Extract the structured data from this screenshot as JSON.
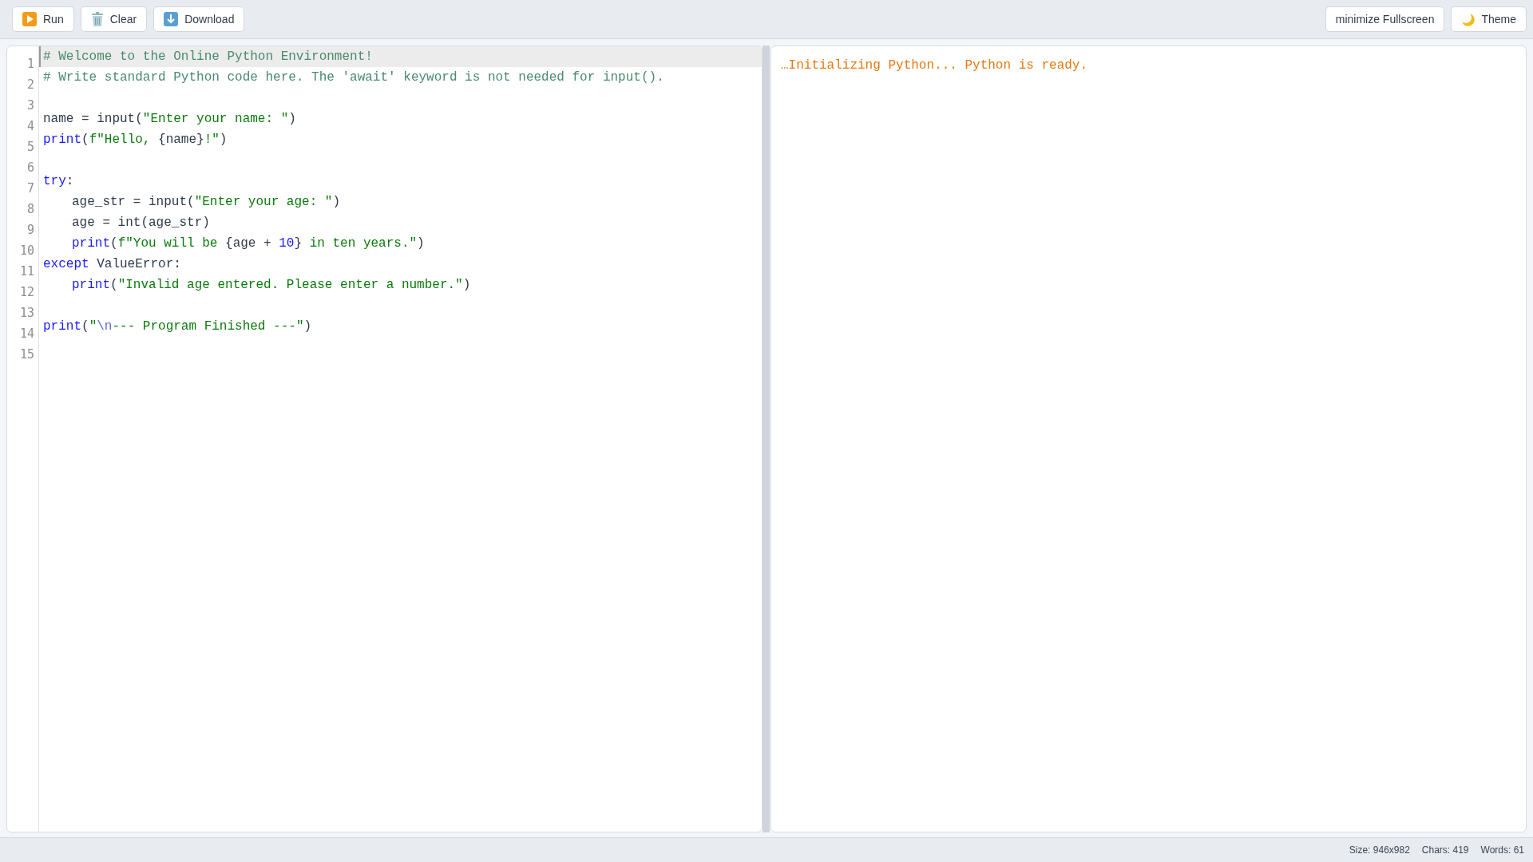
{
  "toolbar": {
    "left_buttons": [
      {
        "kind": "run",
        "label": "Run"
      },
      {
        "kind": "clear",
        "label": "Clear"
      },
      {
        "kind": "download",
        "label": "Download"
      }
    ],
    "right_buttons": [
      {
        "kind": "fullscreen",
        "label": "minimize Fullscreen"
      },
      {
        "kind": "theme",
        "label": "Theme"
      }
    ]
  },
  "editor": {
    "lines": [
      {
        "number": "1",
        "active": true,
        "indented": false,
        "tokens": [
          {
            "kind": "comment",
            "t": "# Welcome to the Online Python Environment!"
          }
        ]
      },
      {
        "number": "2",
        "active": false,
        "indented": false,
        "tokens": [
          {
            "kind": "comment",
            "t": "# Write standard Python code here. The 'await' keyword is not needed for input()."
          }
        ]
      },
      {
        "number": "3",
        "active": false
      },
      {
        "number": "4",
        "active": false,
        "indented": false,
        "tokens": [
          {
            "kind": "plain",
            "t": "name = input("
          },
          {
            "kind": "string",
            "t": "\"Enter your name: \""
          },
          {
            "kind": "plain",
            "t": ")"
          }
        ]
      },
      {
        "number": "5",
        "active": false,
        "indented": false,
        "tokens": [
          {
            "kind": "keyword",
            "t": "print"
          },
          {
            "kind": "plain",
            "t": "("
          },
          {
            "kind": "string",
            "t": "f\"Hello, "
          },
          {
            "kind": "plain",
            "t": "{name}"
          },
          {
            "kind": "string",
            "t": "!\""
          },
          {
            "kind": "plain",
            "t": ")"
          }
        ]
      },
      {
        "number": "6",
        "active": false
      },
      {
        "number": "7",
        "active": false,
        "indented": false,
        "tokens": [
          {
            "kind": "keyword",
            "t": "try"
          },
          {
            "kind": "plain",
            "t": ":"
          }
        ]
      },
      {
        "number": "8",
        "active": false,
        "indented": true,
        "tokens": [
          {
            "kind": "plain",
            "t": "age_str = input("
          },
          {
            "kind": "string",
            "t": "\"Enter your age: \""
          },
          {
            "kind": "plain",
            "t": ")"
          }
        ]
      },
      {
        "number": "9",
        "active": false,
        "indented": true,
        "tokens": [
          {
            "kind": "plain",
            "t": "age = int(age_str)"
          }
        ]
      },
      {
        "number": "10",
        "active": false,
        "indented": true,
        "tokens": [
          {
            "kind": "keyword",
            "t": "print"
          },
          {
            "kind": "plain",
            "t": "("
          },
          {
            "kind": "string",
            "t": "f\"You will be "
          },
          {
            "kind": "plain",
            "t": "{age + "
          },
          {
            "kind": "number",
            "t": "10"
          },
          {
            "kind": "plain",
            "t": "}"
          },
          {
            "kind": "string",
            "t": " in ten years.\""
          },
          {
            "kind": "plain",
            "t": ")"
          }
        ]
      },
      {
        "number": "11",
        "active": false,
        "indented": false,
        "tokens": [
          {
            "kind": "keyword",
            "t": "except"
          },
          {
            "kind": "plain",
            "t": " ValueError:"
          }
        ]
      },
      {
        "number": "12",
        "active": false,
        "indented": true,
        "tokens": [
          {
            "kind": "keyword",
            "t": "print"
          },
          {
            "kind": "plain",
            "t": "("
          },
          {
            "kind": "string",
            "t": "\"Invalid age entered. Please enter a number.\""
          },
          {
            "kind": "plain",
            "t": ")"
          }
        ]
      },
      {
        "number": "13",
        "active": false
      },
      {
        "number": "14",
        "active": false,
        "indented": false,
        "tokens": [
          {
            "kind": "keyword",
            "t": "print"
          },
          {
            "kind": "plain",
            "t": "("
          },
          {
            "kind": "string",
            "t": "\""
          },
          {
            "kind": "escape",
            "t": "\\n"
          },
          {
            "kind": "string",
            "t": "--- Program Finished ---\""
          },
          {
            "kind": "plain",
            "t": ")"
          }
        ]
      },
      {
        "number": "15",
        "active": false
      }
    ]
  },
  "output": {
    "lines": [
      "…Initializing Python... Python is ready."
    ]
  },
  "status_bar": [
    "Size: 946x982",
    "Chars: 419",
    "Words: 61"
  ]
}
